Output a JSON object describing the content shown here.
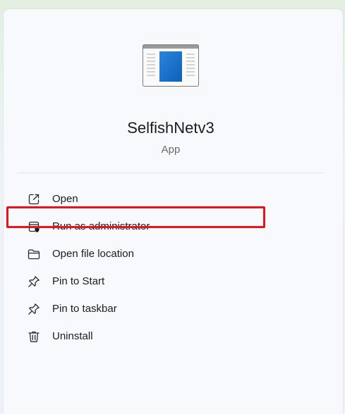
{
  "app": {
    "name": "SelfishNetv3",
    "type": "App",
    "icon": "app-window-icon"
  },
  "menu": {
    "items": [
      {
        "label": "Open",
        "icon": "open-external-icon"
      },
      {
        "label": "Run as administrator",
        "icon": "run-as-admin-shield-icon"
      },
      {
        "label": "Open file location",
        "icon": "folder-icon"
      },
      {
        "label": "Pin to Start",
        "icon": "pin-icon"
      },
      {
        "label": "Pin to taskbar",
        "icon": "pin-icon"
      },
      {
        "label": "Uninstall",
        "icon": "trash-icon"
      }
    ]
  },
  "colors": {
    "highlight": "#e8141b",
    "accent_blue": "#0f6cc8"
  }
}
